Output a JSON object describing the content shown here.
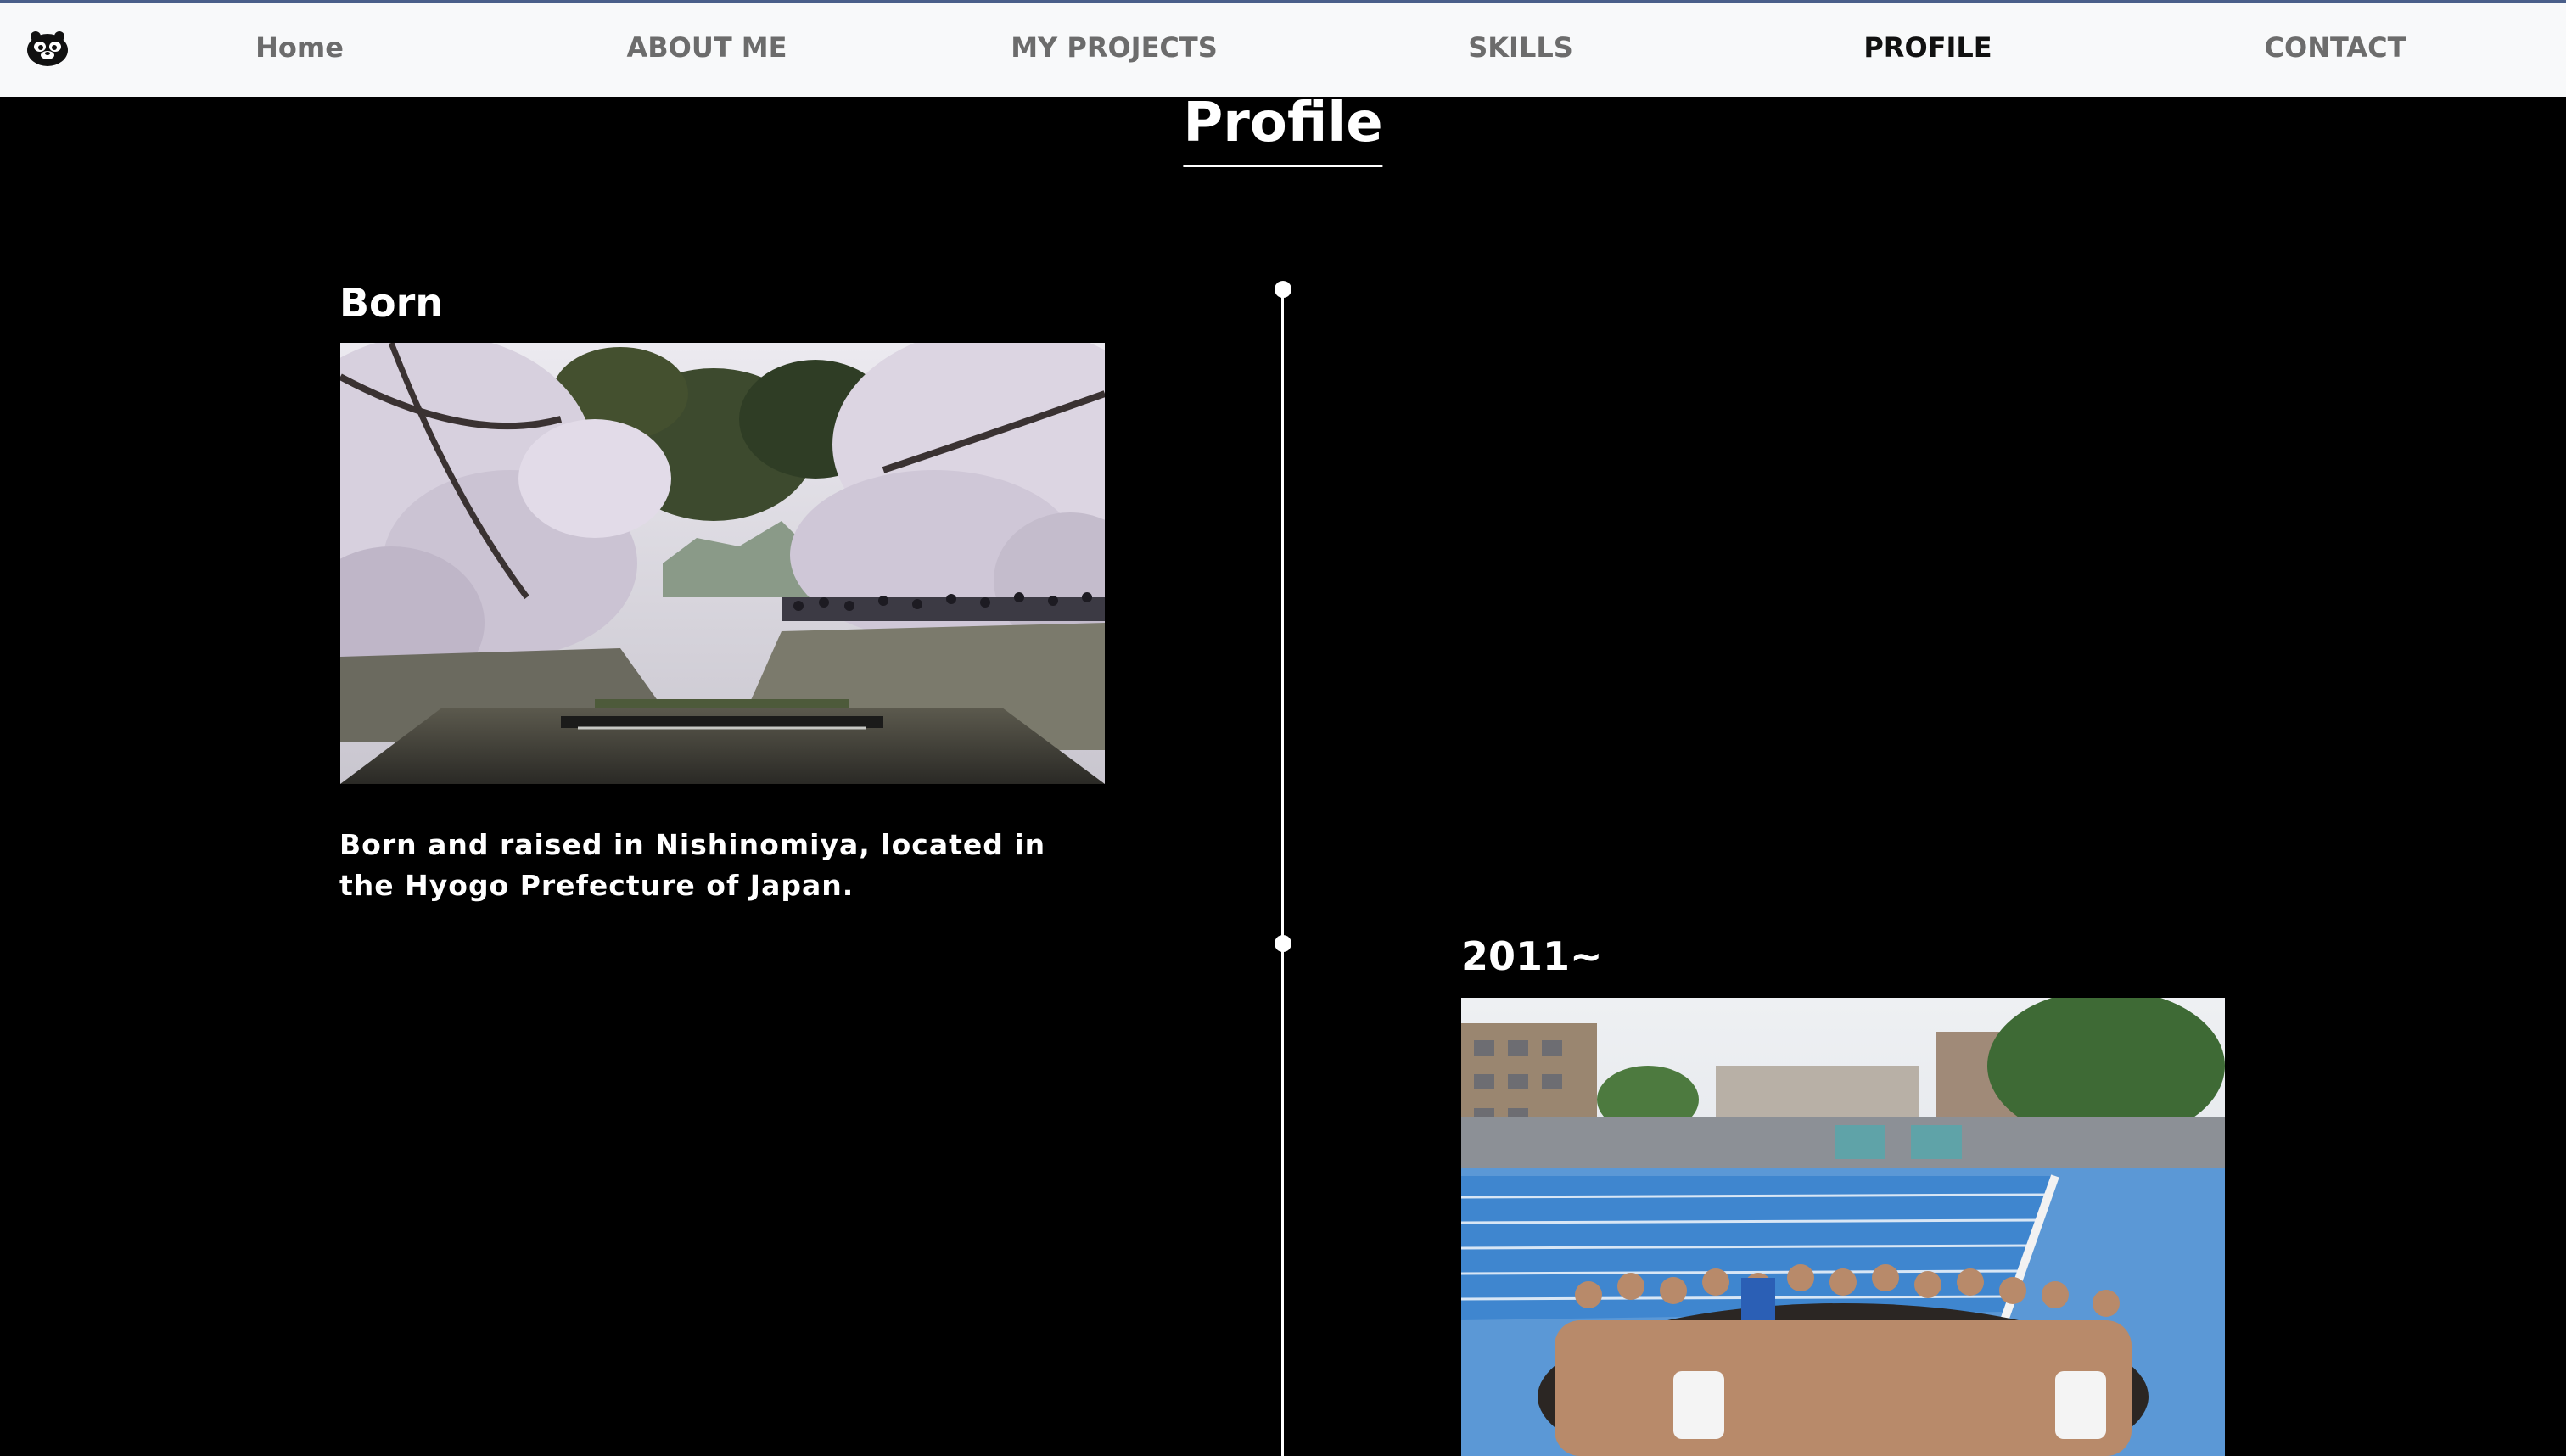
{
  "nav": {
    "logo_icon": "otter-face-logo-icon",
    "items": [
      {
        "label": "Home"
      },
      {
        "label": "ABOUT ME"
      },
      {
        "label": "MY PROJECTS"
      },
      {
        "label": "SKILLS"
      },
      {
        "label": "PROFILE"
      },
      {
        "label": "CONTACT"
      }
    ],
    "active_item": "PROFILE"
  },
  "page": {
    "title": "Profile"
  },
  "timeline": [
    {
      "heading": "Born",
      "photo_description_icon": "cherry-blossom-river-photo",
      "text": "Born and raised in Nishinomiya, located in the Hyogo Prefecture of Japan."
    },
    {
      "heading": "2011~",
      "photo_description_icon": "swim-team-pool-group-photo"
    }
  ],
  "colors": {
    "background": "#000000",
    "navbar": "#f8f9fa",
    "nav_text": "#6c6c6c",
    "nav_active": "#111111",
    "text": "#ffffff"
  }
}
